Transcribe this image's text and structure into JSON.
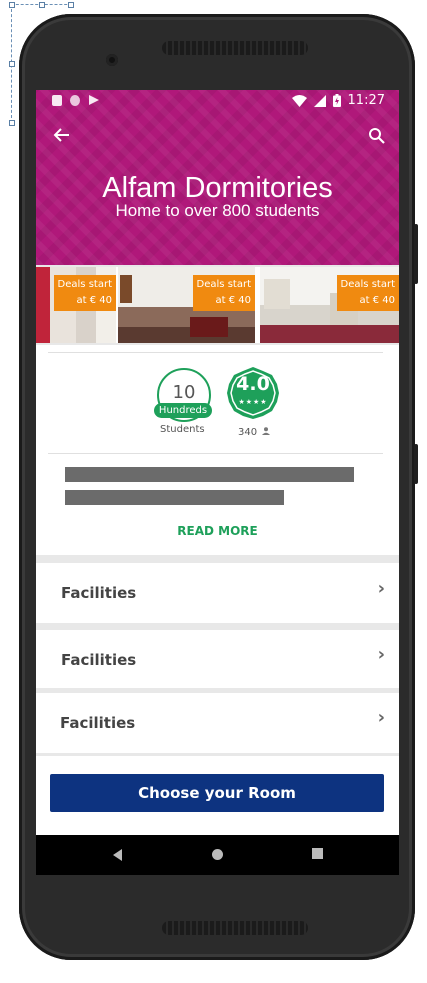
{
  "status_bar": {
    "time": "11:27",
    "left_icons": [
      "sd-card-icon",
      "circle-icon",
      "app-icon"
    ],
    "right_icons": [
      "wifi-icon",
      "signal-icon",
      "battery-icon"
    ]
  },
  "toolbar": {
    "back_icon": "arrow-back-icon",
    "search_icon": "search-icon"
  },
  "hero": {
    "title": "Alfam Dormitories",
    "subtitle": "Home to over 800 students",
    "background_color": "#b0187a"
  },
  "photos": [
    {
      "deal_line1": "Deals start",
      "deal_line2": "at € 40"
    },
    {
      "deal_line1": "Deals start",
      "deal_line2": "at € 40"
    },
    {
      "deal_line1": "Deals start",
      "deal_line2": "at € 40"
    }
  ],
  "stats": {
    "students_number": "10",
    "students_unit": "Hundreds",
    "students_caption": "Students",
    "rating_value": "4.0",
    "rating_stars": "★★★★",
    "rating_count": "340"
  },
  "description": {
    "read_more_label": "READ MORE"
  },
  "facilities": [
    {
      "label": "Facilities"
    },
    {
      "label": "Facilities"
    },
    {
      "label": "Facilities"
    }
  ],
  "cta": {
    "label": "Choose your Room",
    "color": "#0d3380"
  },
  "colors": {
    "accent_green": "#1ea05a",
    "deal_orange": "#f08a10"
  }
}
